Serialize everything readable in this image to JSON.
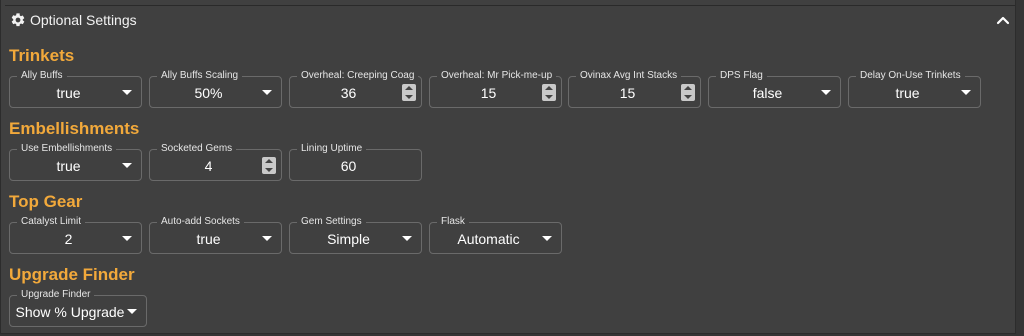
{
  "header": {
    "title": "Optional Settings",
    "gear_icon": "gear-icon",
    "collapse_icon": "chevron-up-icon"
  },
  "colors": {
    "section_title": "#f2a93b",
    "panel_bg": "#404040",
    "field_border": "#6a6a6a"
  },
  "sections": {
    "trinkets": {
      "title": "Trinkets",
      "fields": {
        "ally_buffs": {
          "label": "Ally Buffs",
          "value": "true"
        },
        "ally_buffs_scaling": {
          "label": "Ally Buffs Scaling",
          "value": "50%"
        },
        "overheal_creeping_coag": {
          "label": "Overheal: Creeping Coag",
          "value": "36"
        },
        "overheal_mr_pick_me_up": {
          "label": "Overheal: Mr Pick-me-up",
          "value": "15"
        },
        "ovinax_avg_int_stacks": {
          "label": "Ovinax Avg Int Stacks",
          "value": "15"
        },
        "dps_flag": {
          "label": "DPS Flag",
          "value": "false"
        },
        "delay_on_use_trinkets": {
          "label": "Delay On-Use Trinkets",
          "value": "true"
        }
      }
    },
    "embellishments": {
      "title": "Embellishments",
      "fields": {
        "use_embellishments": {
          "label": "Use Embellishments",
          "value": "true"
        },
        "socketed_gems": {
          "label": "Socketed Gems",
          "value": "4"
        },
        "lining_uptime": {
          "label": "Lining Uptime",
          "value": "60"
        }
      }
    },
    "top_gear": {
      "title": "Top Gear",
      "fields": {
        "catalyst_limit": {
          "label": "Catalyst Limit",
          "value": "2"
        },
        "auto_add_sockets": {
          "label": "Auto-add Sockets",
          "value": "true"
        },
        "gem_settings": {
          "label": "Gem Settings",
          "value": "Simple"
        },
        "flask": {
          "label": "Flask",
          "value": "Automatic"
        }
      }
    },
    "upgrade_finder": {
      "title": "Upgrade Finder",
      "fields": {
        "upgrade_finder": {
          "label": "Upgrade Finder",
          "value": "Show % Upgrade"
        }
      }
    }
  }
}
